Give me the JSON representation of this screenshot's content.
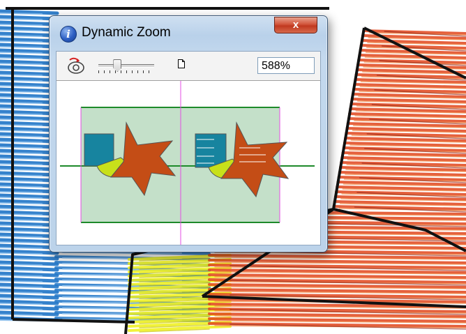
{
  "window": {
    "title": "Dynamic Zoom",
    "close_symbol": "x",
    "info_icon_glyph": "i"
  },
  "toolbar": {
    "zoom_value": "588%",
    "zoom_slider_fraction": 0.33,
    "icons": [
      "eye-dropper-icon",
      "page-icon"
    ]
  },
  "colors": {
    "stitch_blue": "#1f74c7",
    "stitch_red": "#e0451c",
    "stitch_yellow": "#eef018",
    "preview_bg": "#c4e0c9",
    "design_green_line": "#1d8a2a",
    "center_line": "#e34de3",
    "shape_teal": "#17849f",
    "shape_yellow": "#c8e01a",
    "shape_orange": "#c44d16"
  }
}
